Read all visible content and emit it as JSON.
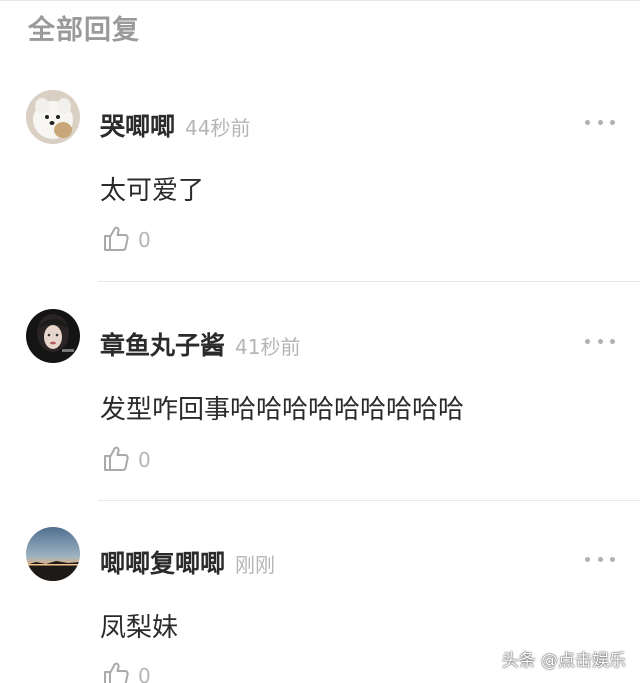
{
  "section": {
    "title": "全部回复"
  },
  "comments": [
    {
      "username": "哭唧唧",
      "time": "44秒前",
      "text": "太可爱了",
      "likes": "0",
      "avatar_icon": "white-dog-avatar"
    },
    {
      "username": "章鱼丸子酱",
      "time": "41秒前",
      "text": "发型咋回事哈哈哈哈哈哈哈哈哈",
      "likes": "0",
      "avatar_icon": "girl-portrait-avatar"
    },
    {
      "username": "唧唧复唧唧",
      "time": "刚刚",
      "text": "凤梨妹",
      "likes": "0",
      "avatar_icon": "sunset-landscape-avatar"
    }
  ],
  "watermark": {
    "text": "头条 @点击娱乐"
  },
  "colors": {
    "username": "#2b2b2b",
    "muted": "#b5b5b5",
    "divider": "#e9e9e9"
  }
}
